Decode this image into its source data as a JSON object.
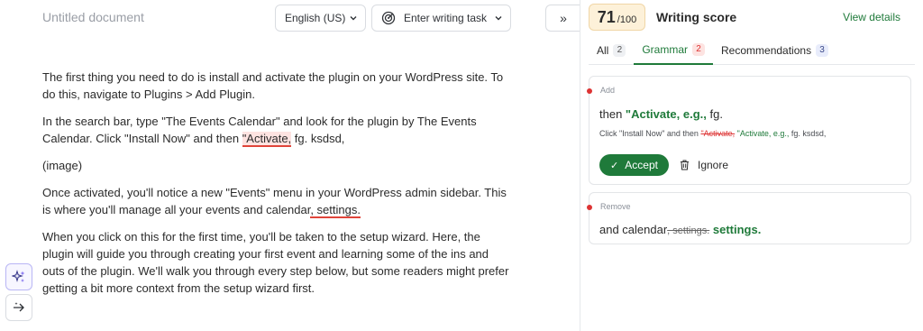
{
  "editor": {
    "doc_title": "Untitled document",
    "language": "English (US)",
    "writing_task_placeholder": "Enter writing task",
    "collapse_label": "»",
    "paragraphs": {
      "p1": "The first thing you need to do is install and activate the plugin on your WordPress site. To do this, navigate to Plugins > Add Plugin.",
      "p2_before": "In the search bar, type \"The Events Calendar\" and look for the plugin by The Events Calendar. Click \"Install Now\" and then ",
      "p2_flag": "\"Activate,",
      "p2_after": " fg. ksdsd,",
      "p3": "(image)",
      "p4_before": "Once activated, you'll notice a new \"Events\" menu in your WordPress admin sidebar. This is where you'll manage all your events and calendar",
      "p4_flag": ",  settings.",
      "p5": "When you click on this for the first time, you'll be taken to the setup wizard. Here, the plugin will guide you through creating your first event and learning some of the ins and outs of the plugin. We'll walk you through every step below, but some readers might prefer getting a bit more context from the setup wizard first."
    },
    "tools": [
      "sparkle-icon",
      "arrow-right-icon"
    ]
  },
  "panel": {
    "score": "71",
    "score_max": "/100",
    "score_label": "Writing score",
    "view_details": "View details",
    "tabs": [
      {
        "label": "All",
        "count": "2"
      },
      {
        "label": "Grammar",
        "count": "2"
      },
      {
        "label": "Recommendations",
        "count": "3"
      }
    ],
    "active_tab": "Grammar",
    "cards": [
      {
        "kind": "Add",
        "main_prefix": "then ",
        "main_bold": "\"Activate, e.g.,",
        "main_suffix": " fg.",
        "ctx_prefix": "Click \"Install Now\" and then ",
        "ctx_removed": "\"Activate,",
        "ctx_added": " \"Activate, e.g.,",
        "ctx_suffix": " fg. ksdsd,",
        "accept_label": "Accept",
        "ignore_label": "Ignore"
      },
      {
        "kind": "Remove",
        "main_prefix": "and calendar",
        "main_removed": ",  settings.",
        "main_bold": " settings."
      }
    ]
  },
  "colors": {
    "accent_green": "#1f7a3a",
    "error_red": "#e0453a",
    "score_bg": "#fdf1d9"
  }
}
